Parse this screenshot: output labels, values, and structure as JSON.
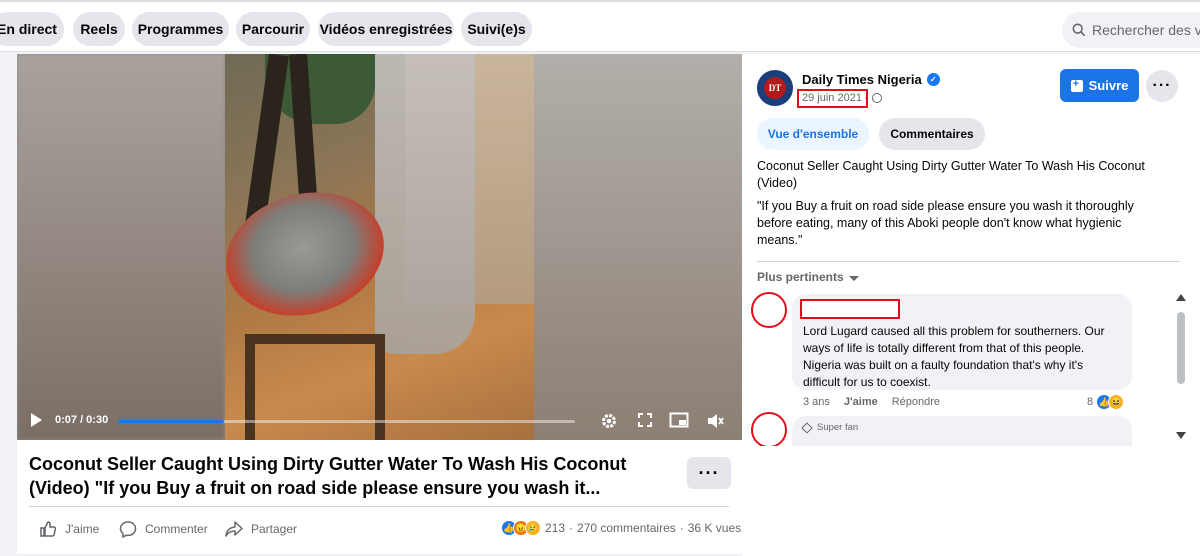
{
  "nav": {
    "tabs": [
      {
        "label": "En direct"
      },
      {
        "label": "Reels"
      },
      {
        "label": "Programmes"
      },
      {
        "label": "Parcourir"
      },
      {
        "label": "Vidéos enregistrées"
      },
      {
        "label": "Suivi(e)s"
      }
    ],
    "search_placeholder": "Rechercher des vi"
  },
  "video": {
    "time": "0:07 / 0:30",
    "progress": 0.233,
    "title": "Coconut Seller Caught Using Dirty Gutter Water To Wash His Coconut (Video) \"If you Buy a fruit on road side please ensure you wash it...",
    "actions": {
      "like": "J'aime",
      "comment": "Commenter",
      "share": "Partager"
    },
    "stats": {
      "reactions": "213",
      "comments": "270 commentaires",
      "views": "36 K vues"
    },
    "icons": [
      "play-icon",
      "settings-icon",
      "fullscreen-icon",
      "miniplayer-icon",
      "mute-icon"
    ]
  },
  "post": {
    "page_name": "Daily Times Nigeria",
    "date": "29 juin 2021",
    "follow_label": "Suivre",
    "tabs": {
      "overview": "Vue d'ensemble",
      "comments": "Commentaires"
    },
    "caption_title": "Coconut Seller Caught Using Dirty Gutter Water To Wash His Coconut (Video)",
    "caption_quote": "\"If you Buy a fruit on road side please ensure you wash it thoroughly before eating, many of this Aboki people don't know what hygienic means.\"",
    "sort_label": "Plus pertinents"
  },
  "comments": [
    {
      "text": "Lord Lugard caused all this problem for southerners. Our ways of life is totally different from that of this people. Nigeria was built on a faulty foundation that's why it's difficult for us to coexist.",
      "age": "3 ans",
      "like_label": "J'aime",
      "reply_label": "Répondre",
      "reaction_count": "8"
    },
    {
      "badge": "Super fan"
    }
  ],
  "colors": {
    "accent": "#1b74e4",
    "annotation": "#e0101a",
    "progress": "#1b74e4"
  }
}
